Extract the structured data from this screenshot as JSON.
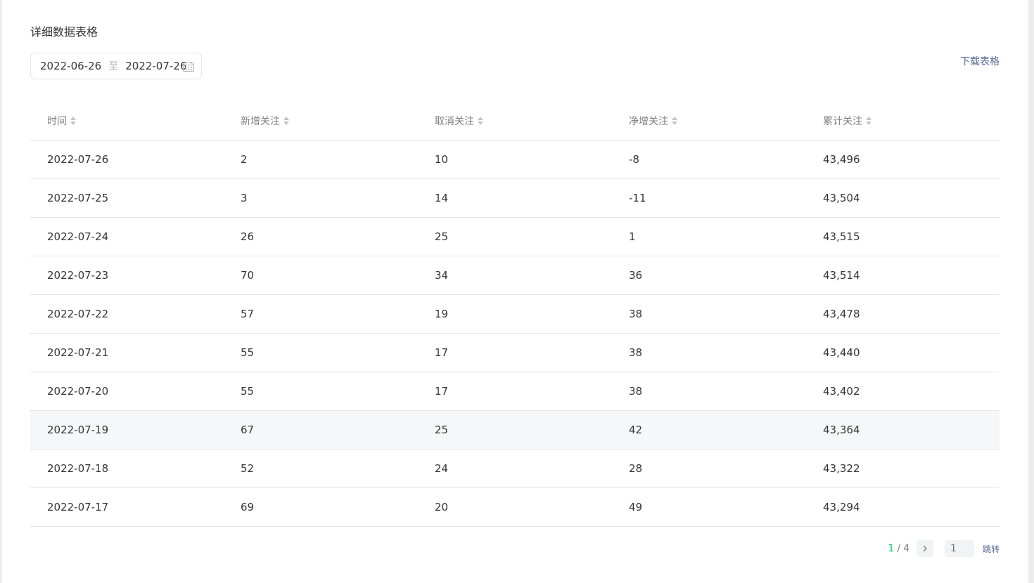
{
  "title": "详细数据表格",
  "date_range": {
    "start": "2022-06-26",
    "separator": "至",
    "end": "2022-07-26"
  },
  "download_label": "下载表格",
  "table": {
    "headers": [
      "时间",
      "新增关注",
      "取消关注",
      "净增关注",
      "累计关注"
    ],
    "rows": [
      [
        "2022-07-26",
        "2",
        "10",
        "-8",
        "43,496"
      ],
      [
        "2022-07-25",
        "3",
        "14",
        "-11",
        "43,504"
      ],
      [
        "2022-07-24",
        "26",
        "25",
        "1",
        "43,515"
      ],
      [
        "2022-07-23",
        "70",
        "34",
        "36",
        "43,514"
      ],
      [
        "2022-07-22",
        "57",
        "19",
        "38",
        "43,478"
      ],
      [
        "2022-07-21",
        "55",
        "17",
        "38",
        "43,440"
      ],
      [
        "2022-07-20",
        "55",
        "17",
        "38",
        "43,402"
      ],
      [
        "2022-07-19",
        "67",
        "25",
        "42",
        "43,364"
      ],
      [
        "2022-07-18",
        "52",
        "24",
        "28",
        "43,322"
      ],
      [
        "2022-07-17",
        "69",
        "20",
        "49",
        "43,294"
      ]
    ]
  },
  "pagination": {
    "current": "1",
    "separator": "/",
    "total": "4",
    "jump_input_placeholder": "1",
    "jump_label": "跳转"
  },
  "colors": {
    "accent_green": "#07c160",
    "link_blue": "#576b95",
    "row_highlight": "#f6f7f8"
  }
}
